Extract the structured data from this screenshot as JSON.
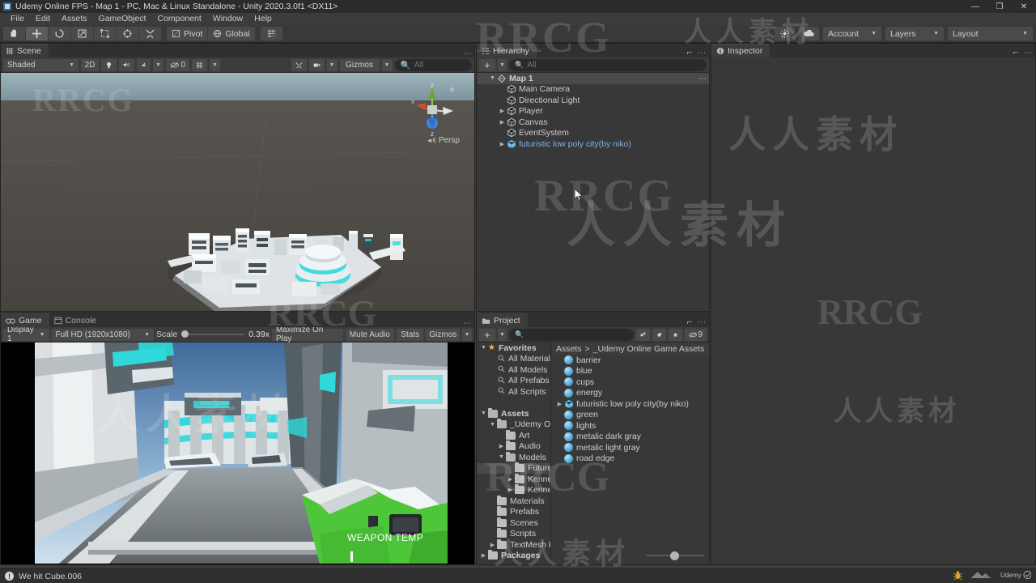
{
  "window": {
    "title": "Udemy Online FPS - Map 1 - PC, Mac & Linux Standalone - Unity 2020.3.0f1 <DX11>",
    "minimize": "—",
    "maximize": "❐",
    "close": "✕"
  },
  "menubar": {
    "items": [
      "File",
      "Edit",
      "Assets",
      "GameObject",
      "Component",
      "Window",
      "Help"
    ]
  },
  "toolbar": {
    "tools": [
      {
        "name": "hand-tool",
        "selected": false
      },
      {
        "name": "move-tool",
        "selected": true
      },
      {
        "name": "rotate-tool",
        "selected": false
      },
      {
        "name": "scale-tool",
        "selected": false
      },
      {
        "name": "rect-tool",
        "selected": false
      },
      {
        "name": "transform-tool",
        "selected": false
      },
      {
        "name": "custom-editor-tool",
        "selected": false
      }
    ],
    "pivot_label": "Pivot",
    "global_label": "Global",
    "right": {
      "collab_icon": "collab-icon",
      "cloud_icon": "cloud-icon",
      "account_label": "Account",
      "layers_label": "Layers",
      "layout_label": "Layout"
    }
  },
  "scene": {
    "tab_label": "Scene",
    "shading_mode": "Shaded",
    "mode_2d": "2D",
    "lighting_icon": "lighting-icon",
    "audio_icon": "audio-icon",
    "fx_icon": "effects-icon",
    "hidden_objects_count": "0",
    "grid_icon": "grid-icon",
    "gizmos_label": "Gizmos",
    "search_placeholder": "All",
    "gizmo": {
      "x": "x",
      "y": "y",
      "z": "z",
      "projection": "Persp"
    }
  },
  "hierarchy": {
    "tab_label": "Hierarchy",
    "add_label": "+",
    "search_placeholder": "All",
    "items": [
      {
        "label": "Map 1",
        "depth": 0,
        "arrow": "open",
        "icon": "scene-icon",
        "selected": true,
        "bold": true,
        "kebab": true
      },
      {
        "label": "Main Camera",
        "depth": 1,
        "arrow": "none",
        "icon": "gameobject-icon",
        "selected": false
      },
      {
        "label": "Directional Light",
        "depth": 1,
        "arrow": "none",
        "icon": "gameobject-icon",
        "selected": false
      },
      {
        "label": "Player",
        "depth": 1,
        "arrow": "closed",
        "icon": "gameobject-icon",
        "selected": false
      },
      {
        "label": "Canvas",
        "depth": 1,
        "arrow": "closed",
        "icon": "gameobject-icon",
        "selected": false
      },
      {
        "label": "EventSystem",
        "depth": 1,
        "arrow": "none",
        "icon": "gameobject-icon",
        "selected": false
      },
      {
        "label": "futuristic low poly city(by niko)",
        "depth": 1,
        "arrow": "closed",
        "icon": "prefab-icon",
        "selected": false,
        "prefab": true
      }
    ]
  },
  "inspector": {
    "tab_label": "Inspector"
  },
  "game": {
    "tab_label": "Game",
    "console_tab_label": "Console",
    "display_label": "Display 1",
    "resolution_label": "Full HD (1920x1080)",
    "scale_label": "Scale",
    "scale_value": "0.39x",
    "maximize_label": "Maximize On Play",
    "mute_label": "Mute Audio",
    "stats_label": "Stats",
    "gizmos_label": "Gizmos",
    "hud_weapon_temp": "WEAPON TEMP"
  },
  "project": {
    "tab_label": "Project",
    "add_label": "+",
    "search_placeholder": "",
    "icons": [
      "prefab-filter-icon",
      "label-filter-icon",
      "favorite-filter-icon",
      "hidden-packages-icon"
    ],
    "hidden_packages_count": "9",
    "breadcrumb": [
      "Assets",
      "_Udemy Online Game Assets"
    ],
    "breadcrumb_separator": ">",
    "tree": [
      {
        "label": "Favorites",
        "depth": 0,
        "arrow": "open",
        "icon": "star-icon",
        "bold": true
      },
      {
        "label": "All Materials",
        "depth": 1,
        "arrow": "none",
        "icon": "search-icon"
      },
      {
        "label": "All Models",
        "depth": 1,
        "arrow": "none",
        "icon": "search-icon"
      },
      {
        "label": "All Prefabs",
        "depth": 1,
        "arrow": "none",
        "icon": "search-icon"
      },
      {
        "label": "All Scripts",
        "depth": 1,
        "arrow": "none",
        "icon": "search-icon"
      },
      {
        "label": "",
        "depth": 0,
        "arrow": "none",
        "icon": "none",
        "spacer": true
      },
      {
        "label": "Assets",
        "depth": 0,
        "arrow": "open",
        "icon": "folder-open-icon",
        "bold": true
      },
      {
        "label": "_Udemy Onl",
        "depth": 1,
        "arrow": "open",
        "icon": "folder-open-icon"
      },
      {
        "label": "Art",
        "depth": 2,
        "arrow": "none",
        "icon": "folder-icon"
      },
      {
        "label": "Audio",
        "depth": 2,
        "arrow": "closed",
        "icon": "folder-icon"
      },
      {
        "label": "Models",
        "depth": 2,
        "arrow": "open",
        "icon": "folder-open-icon"
      },
      {
        "label": "Future",
        "depth": 3,
        "arrow": "none",
        "icon": "folder-icon",
        "selected": true
      },
      {
        "label": "Kenne",
        "depth": 3,
        "arrow": "closed",
        "icon": "folder-icon"
      },
      {
        "label": "Kenne",
        "depth": 3,
        "arrow": "closed",
        "icon": "folder-icon"
      },
      {
        "label": "Materials",
        "depth": 1,
        "arrow": "none",
        "icon": "folder-icon"
      },
      {
        "label": "Prefabs",
        "depth": 1,
        "arrow": "none",
        "icon": "folder-icon"
      },
      {
        "label": "Scenes",
        "depth": 1,
        "arrow": "none",
        "icon": "folder-icon"
      },
      {
        "label": "Scripts",
        "depth": 1,
        "arrow": "none",
        "icon": "folder-icon"
      },
      {
        "label": "TextMesh P",
        "depth": 1,
        "arrow": "closed",
        "icon": "folder-icon"
      },
      {
        "label": "Packages",
        "depth": 0,
        "arrow": "closed",
        "icon": "folder-icon",
        "bold": true
      }
    ],
    "assets": [
      {
        "label": "barrier",
        "type": "material",
        "arrow": "none"
      },
      {
        "label": "blue",
        "type": "material",
        "arrow": "none"
      },
      {
        "label": "cups",
        "type": "material",
        "arrow": "none"
      },
      {
        "label": "energy",
        "type": "material",
        "arrow": "none"
      },
      {
        "label": "futuristic low poly city(by niko)",
        "type": "prefab",
        "arrow": "closed"
      },
      {
        "label": "green",
        "type": "material",
        "arrow": "none"
      },
      {
        "label": "lights",
        "type": "material",
        "arrow": "none"
      },
      {
        "label": "metalic dark gray",
        "type": "material",
        "arrow": "none"
      },
      {
        "label": "metalic light gray",
        "type": "material",
        "arrow": "none"
      },
      {
        "label": "road edge",
        "type": "material",
        "arrow": "none"
      }
    ]
  },
  "statusbar": {
    "message": "We hit Cube.006",
    "message_icon": "info-icon",
    "right_icons": [
      "bug-icon",
      "unity-collab-icon",
      "udemy-logo"
    ]
  },
  "watermarks": {
    "top": "RRCG",
    "chinese": "人人素材",
    "small": "RRCG"
  },
  "colors": {
    "panel_bg": "#383838",
    "toolbar_bg": "#393939",
    "tab_active": "#3c3c3c",
    "selection": "#4a4a4a",
    "prefab_blue": "#7fb2e5",
    "accent_cyan": "#2fd8da",
    "weapon_green": "#4ec63a"
  }
}
